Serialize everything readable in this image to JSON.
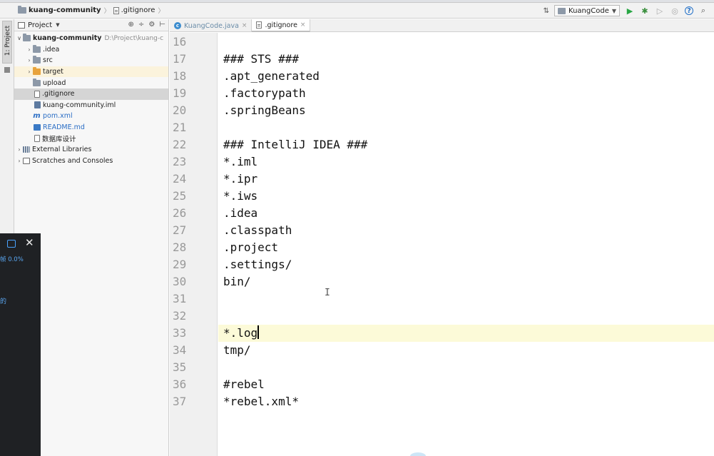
{
  "navbar": {
    "project": "kuang-community",
    "file": ".gitignore",
    "run_config": "KuangCode"
  },
  "tool_stripe": {
    "project_tab": "1: Project"
  },
  "project_panel": {
    "header": "Project",
    "tree": [
      {
        "label": "kuang-community",
        "path": "D:\\Project\\kuang-c",
        "icon": "folder-icon",
        "expanded": true
      },
      {
        "label": ".idea",
        "icon": "folder-icon"
      },
      {
        "label": "src",
        "icon": "folder-icon"
      },
      {
        "label": "target",
        "icon": "folder-orange-icon"
      },
      {
        "label": "upload",
        "icon": "folder-icon"
      },
      {
        "label": ".gitignore",
        "icon": "file-icon"
      },
      {
        "label": "kuang-community.iml",
        "icon": "iml-icon"
      },
      {
        "label": "pom.xml",
        "icon": "maven-icon"
      },
      {
        "label": "README.md",
        "icon": "markdown-icon"
      },
      {
        "label": "数据库设计",
        "icon": "file-icon"
      },
      {
        "label": "External Libraries",
        "icon": "library-icon"
      },
      {
        "label": "Scratches and Consoles",
        "icon": "scratch-icon"
      }
    ]
  },
  "overlay": {
    "text1": "帧 0.0%",
    "text2": "的"
  },
  "editor": {
    "tabs": [
      {
        "label": "KuangCode.java",
        "active": false
      },
      {
        "label": ".gitignore",
        "active": true
      }
    ],
    "lines": [
      {
        "num": "16",
        "text": ""
      },
      {
        "num": "17",
        "text": "### STS ###"
      },
      {
        "num": "18",
        "text": ".apt_generated"
      },
      {
        "num": "19",
        "text": ".factorypath"
      },
      {
        "num": "20",
        "text": ".springBeans"
      },
      {
        "num": "21",
        "text": ""
      },
      {
        "num": "22",
        "text": "### IntelliJ IDEA ###"
      },
      {
        "num": "23",
        "text": "*.iml"
      },
      {
        "num": "24",
        "text": "*.ipr"
      },
      {
        "num": "25",
        "text": "*.iws"
      },
      {
        "num": "26",
        "text": ".idea"
      },
      {
        "num": "27",
        "text": ".classpath"
      },
      {
        "num": "28",
        "text": ".project"
      },
      {
        "num": "29",
        "text": ".settings/"
      },
      {
        "num": "30",
        "text": "bin/"
      },
      {
        "num": "31",
        "text": ""
      },
      {
        "num": "32",
        "text": ""
      },
      {
        "num": "33",
        "text": "*.log"
      },
      {
        "num": "34",
        "text": "tmp/"
      },
      {
        "num": "35",
        "text": ""
      },
      {
        "num": "36",
        "text": "#rebel"
      },
      {
        "num": "37",
        "text": "*rebel.xml*"
      }
    ],
    "current_line": "33"
  }
}
